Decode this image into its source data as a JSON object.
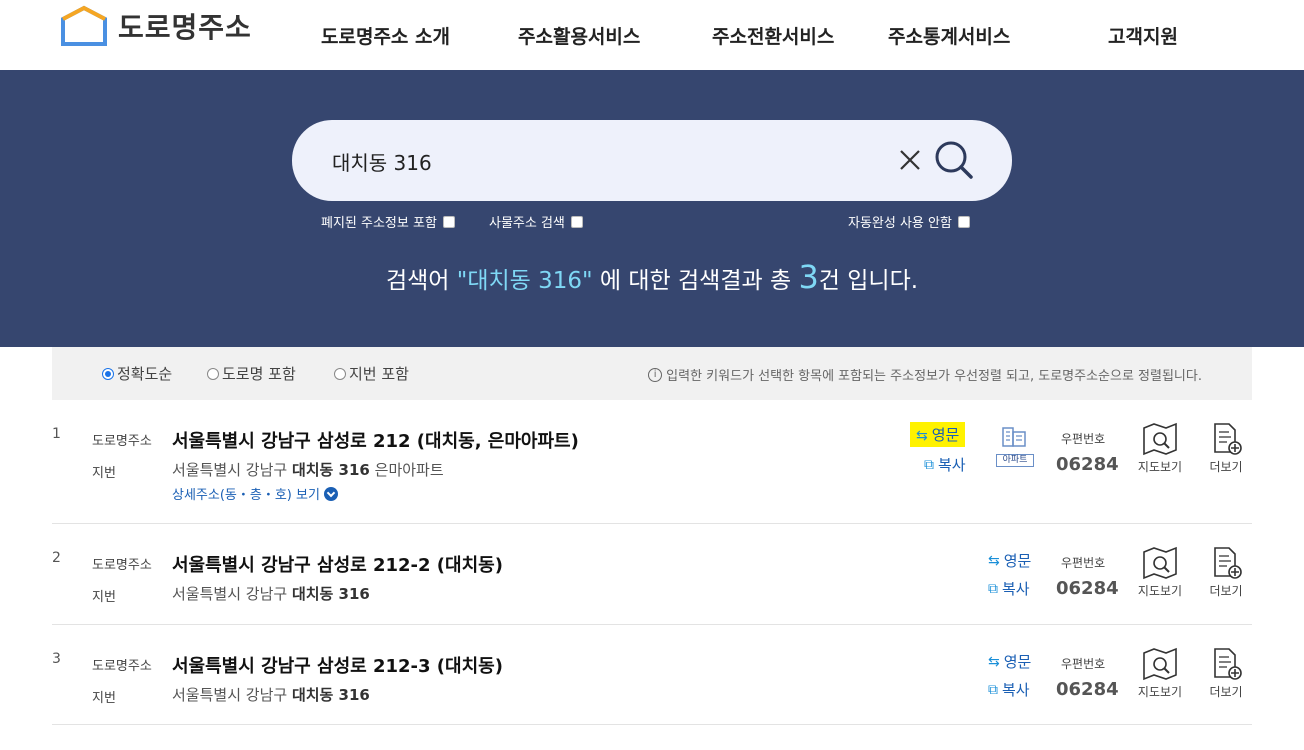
{
  "header": {
    "logo_text": "도로명주소",
    "nav": [
      "도로명주소 소개",
      "주소활용서비스",
      "주소전환서비스",
      "주소통계서비스",
      "고객지원"
    ]
  },
  "search": {
    "value": "대치동 316",
    "options": {
      "abolished": "폐지된 주소정보 포함",
      "building": "사물주소 검색",
      "autocomplete": "자동완성 사용 안함"
    },
    "summary": {
      "prefix": "검색어 ",
      "keyword": "\"대치동 316\"",
      "middle": " 에 대한 검색결과 총 ",
      "count": "3",
      "suffix": "건 입니다."
    }
  },
  "filter": {
    "options": [
      "정확도순",
      "도로명 포함",
      "지번 포함"
    ],
    "selected": "정확도순",
    "note": "입력한 키워드가 선택한 항목에 포함되는 주소정보가 우선정렬 되고, 도로명주소순으로 정렬됩니다."
  },
  "labels": {
    "road": "도로명주소",
    "jibun": "지번",
    "english": "영문",
    "copy": "복사",
    "zip_label": "우편번호",
    "map": "지도보기",
    "more": "더보기",
    "apt": "아파트",
    "detail": "상세주소(동・층・호) 보기"
  },
  "results": [
    {
      "num": "1",
      "road": "서울특별시 강남구 삼성로 212 (대치동, 은마아파트)",
      "jibun_pre": "서울특별시 강남구 ",
      "jibun_bold": "대치동 316",
      "jibun_post": " 은마아파트",
      "zip": "06284"
    },
    {
      "num": "2",
      "road": "서울특별시 강남구 삼성로 212-2 (대치동)",
      "jibun_pre": "서울특별시 강남구 ",
      "jibun_bold": "대치동 316",
      "jibun_post": "",
      "zip": "06284"
    },
    {
      "num": "3",
      "road": "서울특별시 강남구 삼성로 212-3 (대치동)",
      "jibun_pre": "서울특별시 강남구 ",
      "jibun_bold": "대치동 316",
      "jibun_post": "",
      "zip": "06284"
    }
  ],
  "colors": {
    "hero": "#36466f",
    "accent": "#7fd8f5",
    "link": "#1a5fb4",
    "highlight": "#fff200"
  }
}
